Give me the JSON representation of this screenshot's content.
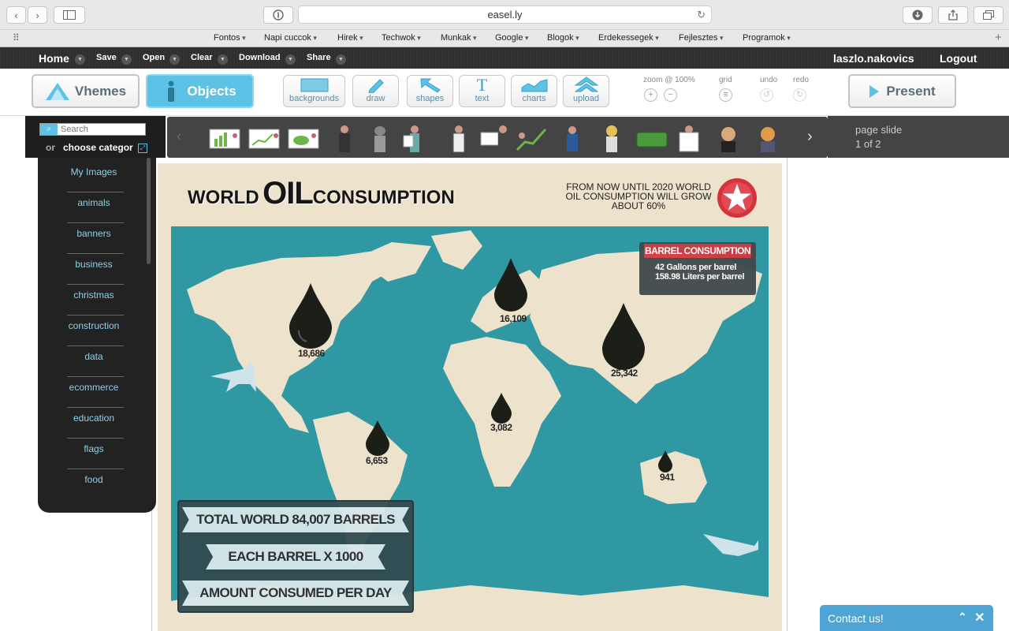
{
  "browser": {
    "url": "easel.ly",
    "bookmarks": [
      "Fontos",
      "Napi cuccok",
      "Hirek",
      "Techwok",
      "Munkak",
      "Google",
      "Blogok",
      "Erdekessegek",
      "Fejlesztes",
      "Programok"
    ]
  },
  "menubar": {
    "items": [
      "Home",
      "Save",
      "Open",
      "Clear",
      "Download",
      "Share"
    ],
    "user": "laszlo.nakovics",
    "logout": "Logout"
  },
  "toolbar": {
    "vhemes": "Vhemes",
    "objects": "Objects",
    "tools": [
      "backgrounds",
      "draw",
      "shapes",
      "text",
      "charts",
      "upload"
    ],
    "zoom_label": "zoom @ 100%",
    "grid_label": "grid",
    "undo_label": "undo",
    "redo_label": "redo",
    "present": "Present"
  },
  "objects_panel": {
    "search_placeholder": "Search",
    "or_label": "or",
    "choose_category": "choose categor",
    "page_slide_label": "page slide",
    "page_slide_count": "1 of 2"
  },
  "sidebar": {
    "categories": [
      "My Images",
      "animals",
      "banners",
      "business",
      "christmas",
      "construction",
      "data",
      "ecommerce",
      "education",
      "flags",
      "food"
    ]
  },
  "infographic": {
    "title_world": "WORLD",
    "title_oil": "OIL",
    "title_consumption": "CONSUMPTION",
    "note": "FROM NOW UNTIL 2020 WORLD OIL CONSUMPTION WILL GROW ABOUT 60%",
    "barrel_title": "BARREL CONSUMPTION",
    "barrel_line1": "42 Gallons per barrel",
    "barrel_line2": "158.98 Liters per barrel",
    "regions": [
      {
        "value": "18,686"
      },
      {
        "value": "16,109"
      },
      {
        "value": "25,342"
      },
      {
        "value": "3,082"
      },
      {
        "value": "6,653"
      },
      {
        "value": "941"
      }
    ],
    "banner1": "TOTAL WORLD 84,007 BARRELS",
    "banner2": "EACH BARREL X 1000",
    "banner3": "AMOUNT CONSUMED PER DAY"
  },
  "contact": {
    "label": "Contact us!"
  },
  "colors": {
    "accent": "#5ec2e6",
    "map_sea": "#2f98a2",
    "land": "#ede2cc",
    "star_badge": "#d6323c"
  }
}
